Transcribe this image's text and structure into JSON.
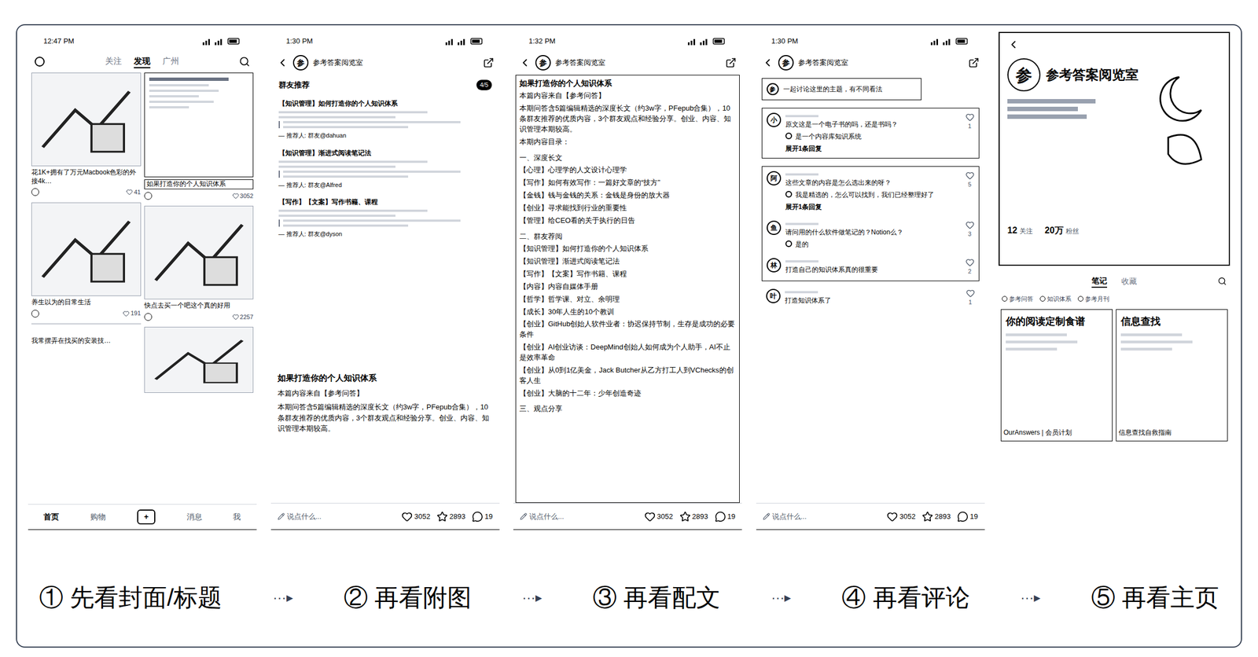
{
  "feed_screen": {
    "status_time": "12:47 PM",
    "nav_tabs": [
      {
        "label": "关注",
        "selected": false
      },
      {
        "label": "发现",
        "selected": true
      },
      {
        "label": "广州",
        "selected": false
      }
    ],
    "left_cards": [
      {
        "kind": "photo",
        "title": "花1K+拥有了万元Macbook色彩的外接4k…",
        "likes": "41"
      },
      {
        "kind": "photo",
        "title": "养生以为的日常生活",
        "likes": "191"
      },
      {
        "kind": "cut",
        "title": "我常摆弄在找买的安装技…",
        "likes": "0"
      }
    ],
    "right_cards": [
      {
        "kind": "screenshot",
        "title": "如果打造你的个人知识体系",
        "likes": "3052"
      },
      {
        "kind": "photo",
        "title": "快点去买一个吧这个真的好用",
        "likes": "2257"
      }
    ],
    "tabbar": [
      {
        "label": "首页",
        "selected": true,
        "kind": "text"
      },
      {
        "label": "购物",
        "selected": false,
        "kind": "text"
      },
      {
        "label": "+",
        "selected": false,
        "kind": "add"
      },
      {
        "label": "消息",
        "selected": false,
        "kind": "text"
      },
      {
        "label": "我",
        "selected": false,
        "kind": "text"
      }
    ]
  },
  "author": {
    "avatar": "参",
    "name": "参考答案阅览室"
  },
  "bottom_bar": {
    "input": "说点什么...",
    "likes": "3052",
    "stars": "2893",
    "comments": "19"
  },
  "note_screen": {
    "status_time": "1:30 PM",
    "image": {
      "heading": "群友推荐",
      "page": "4/5",
      "items": [
        {
          "title": "【知识管理】如何打造你的个人知识体系",
          "by": "— 推荐人: 群友@dahuan"
        },
        {
          "title": "【知识管理】渐进式阅读笔记法",
          "by": "— 推荐人: 群友@Alfred"
        },
        {
          "title": "【写作】【文案】写作书籍、课程",
          "by": "— 推荐人: 群友@dyson"
        }
      ]
    },
    "title": "如果打造你的个人知识体系",
    "source": "本篇内容来自【参考问答】",
    "body": "本期问答含5篇编辑精选的深度长文（约3w字，PFepub合集），10条群友推荐的优质内容，3个群友观点和经验分享。创业、内容、知识管理本期较高。"
  },
  "text_screen": {
    "status_time": "1:32 PM",
    "lines": [
      {
        "kind": "title",
        "text": "如果打造你的个人知识体系"
      },
      {
        "kind": "para",
        "text": "本篇内容来自【参考问答】"
      },
      {
        "kind": "para",
        "text": "本期问答含5篇编辑精选的深度长文（约3w字，PFepub合集），10条群友推荐的优质内容，3个群友观点和经验分享。创业、内容、知识管理本期较高。"
      },
      {
        "kind": "para",
        "text": "本期内容目录："
      },
      {
        "kind": "heading",
        "text": "一、深度长文"
      },
      {
        "kind": "item",
        "text": "【心理】心理学的人文设计心理学"
      },
      {
        "kind": "item",
        "text": "【写作】如何有效写作：一篇好文章的“技方”"
      },
      {
        "kind": "item",
        "text": "【金钱】钱与金钱的关系：金钱是身份的放大器"
      },
      {
        "kind": "item",
        "text": "【创业】寻求能找到行业的重要性"
      },
      {
        "kind": "item",
        "text": "【管理】给CEO看的关于执行的日告"
      },
      {
        "kind": "heading",
        "text": "二、群友荐阅"
      },
      {
        "kind": "item",
        "text": "【知识管理】如何打造你的个人知识体系"
      },
      {
        "kind": "item",
        "text": "【知识管理】渐进式阅读笔记法"
      },
      {
        "kind": "item",
        "text": "【写作】【文案】写作书籍、课程"
      },
      {
        "kind": "item",
        "text": "【内容】内容自媒体手册"
      },
      {
        "kind": "item",
        "text": "【哲学】哲学课、对立、余明理"
      },
      {
        "kind": "item",
        "text": "【成长】30年人生的10个教训"
      },
      {
        "kind": "item",
        "text": "【创业】GitHub创始人软件业者：协迟保持节制，生存是成功的必要条件"
      },
      {
        "kind": "item",
        "text": "【创业】AI创业访谈：DeepMind创始人如何成为个人助手，AI不止是效率革命"
      },
      {
        "kind": "item",
        "text": "【创业】从0到1亿美金，Jack Butcher从乙方打工人到VChecks的创客人生"
      },
      {
        "kind": "item",
        "text": "【创业】大脑的十二年：少年创造奇迹"
      },
      {
        "kind": "heading",
        "text": "三、观点分享"
      }
    ]
  },
  "comments_screen": {
    "status_time": "1:30 PM",
    "pinned": "一起讨论这里的主题，有不同看法",
    "groups": [
      {
        "highlighted": true,
        "comments": [
          {
            "avatar": "小",
            "text": "原文这是一个电子书的吗，还是书吗？",
            "reply": "是一个内容库知识系统",
            "expand": "展开1条回复",
            "likes": "1"
          }
        ]
      },
      {
        "highlighted": true,
        "comments": [
          {
            "avatar": "阿",
            "text": "这些文章的内容是怎么选出来的呀？",
            "reply": "我是精选的，怎么可以找到，我们已经整理好了",
            "expand": "展开1条回复",
            "likes": "5"
          },
          {
            "avatar": "鱼",
            "text": "请问用的什么软件做笔记的？Notion么？",
            "reply": "是的",
            "expand": "",
            "likes": "3"
          },
          {
            "avatar": "林",
            "text": "打造自己的知识体系真的很重要",
            "reply": "",
            "expand": "",
            "likes": "2"
          }
        ]
      },
      {
        "highlighted": false,
        "comments": [
          {
            "avatar": "叶",
            "text": "打造知识体系了",
            "reply": "",
            "expand": "",
            "likes": "1"
          }
        ]
      }
    ]
  },
  "profile_screen": {
    "name": "参考答案阅览室",
    "avatar": "参",
    "stats": [
      {
        "value": "12",
        "label": "关注"
      },
      {
        "value": "20万",
        "label": "粉丝"
      }
    ],
    "tabs": [
      {
        "label": "笔记",
        "selected": true
      },
      {
        "label": "收藏",
        "selected": false
      }
    ],
    "filters": [
      {
        "label": "参考问答",
        "selected": false
      },
      {
        "label": "知识体系",
        "selected": false
      },
      {
        "label": "参考月刊",
        "selected": false
      }
    ],
    "cards": [
      {
        "cover": "你的阅读定制食谱",
        "title": "OurAnswers | 会员计划"
      },
      {
        "cover": "信息查找",
        "title": "信息查找自救指南"
      }
    ]
  },
  "steps": [
    {
      "number": "①",
      "label": "先看封面/标题"
    },
    {
      "number": "②",
      "label": "再看附图"
    },
    {
      "number": "③",
      "label": "再看配文"
    },
    {
      "number": "④",
      "label": "再看评论"
    },
    {
      "number": "⑤",
      "label": "再看主页"
    }
  ],
  "arrow": "···▸"
}
